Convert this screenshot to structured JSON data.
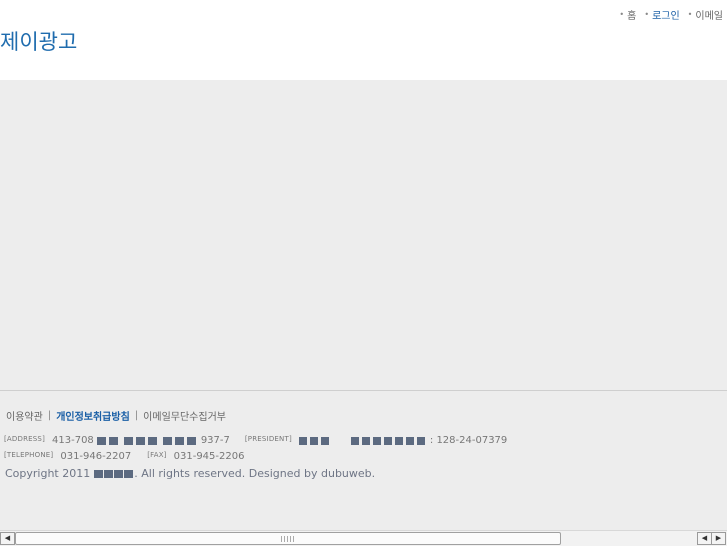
{
  "header": {
    "logo": "제이광고",
    "nav": [
      {
        "bullet": "•",
        "label": "홈"
      },
      {
        "bullet": "•",
        "label": "로그인"
      },
      {
        "bullet": "•",
        "label": "이메일"
      }
    ]
  },
  "footer": {
    "links": {
      "terms": "이용약관",
      "privacy": "개인정보취급방침",
      "no_email": "이메일무단수집거부",
      "separator": "|"
    },
    "address_tag": "[ADDRESS]",
    "address_prefix": "413-708",
    "address_suffix": "937-7",
    "president_tag": "[PRESIDENT]",
    "business_no": ": 128-24-07379",
    "telephone_tag": "[TELEPHONE]",
    "telephone": "031-946-2207",
    "fax_tag": "[FAX]",
    "fax": "031-945-2206",
    "copyright_prefix": "Copyright  2011",
    "copyright_suffix": ". All rights reserved. Designed by dubuweb."
  },
  "scrollbar": {
    "left_arrow": "◀",
    "right_arrow": "▶"
  },
  "colors": {
    "brand_blue": "#1f6cae",
    "link_blue": "#1a5fa6",
    "background": "#ededed"
  }
}
